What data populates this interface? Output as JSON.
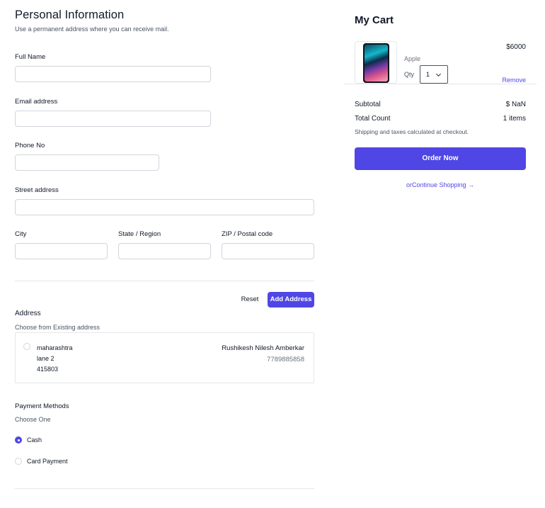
{
  "form": {
    "title": "Personal Information",
    "subtitle": "Use a permanent address where you can receive mail.",
    "full_name_label": "Full Name",
    "full_name_value": "",
    "email_label": "Email address",
    "email_value": "",
    "phone_label": "Phone No",
    "phone_value": "",
    "street_label": "Street address",
    "street_value": "",
    "city_label": "City",
    "city_value": "",
    "state_label": "State / Region",
    "state_value": "",
    "zip_label": "ZIP / Postal code",
    "zip_value": "",
    "reset_label": "Reset",
    "add_address_label": "Add Address"
  },
  "address": {
    "heading": "Address",
    "subheading": "Choose from Existing address",
    "items": [
      {
        "state": "maharashtra",
        "street": "lane 2",
        "pin": "415803",
        "name": "Rushikesh Nilesh Amberkar",
        "phone": "7789885858"
      }
    ]
  },
  "payment": {
    "heading": "Payment Methods",
    "subheading": "Choose One",
    "options": [
      {
        "label": "Cash",
        "selected": true
      },
      {
        "label": "Card Payment",
        "selected": false
      }
    ]
  },
  "cart": {
    "title": "My Cart",
    "items": [
      {
        "brand": "Apple",
        "price": "$6000",
        "qty_label": "Qty",
        "qty": "1",
        "remove_label": "Remove"
      }
    ],
    "subtotal_label": "Subtotal",
    "subtotal_value": "$ NaN",
    "count_label": "Total Count",
    "count_value": "1 items",
    "shipping_note": "Shipping and taxes calculated at checkout.",
    "order_label": "Order Now",
    "continue_prefix": "or",
    "continue_label": "Continue Shopping",
    "continue_arrow": "→"
  },
  "colors": {
    "accent": "#4f46e5",
    "border": "#d1d5db"
  }
}
